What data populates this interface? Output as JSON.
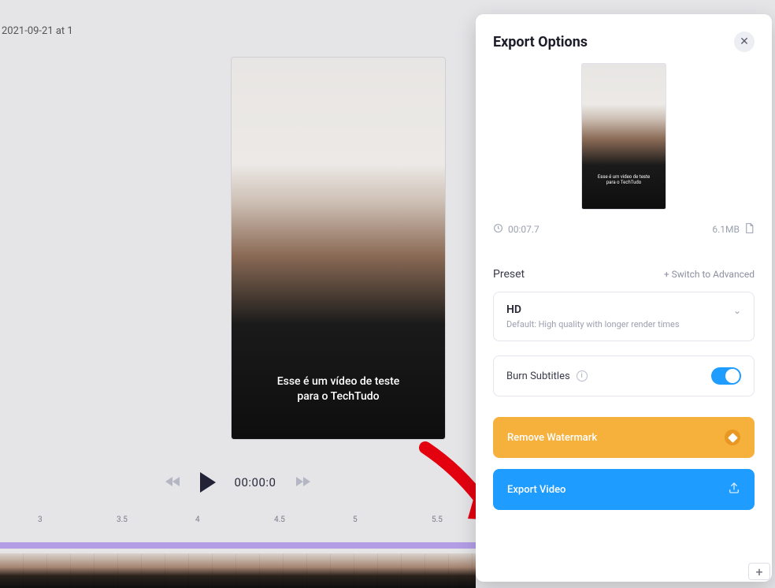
{
  "main": {
    "filename": "2021-09-21 at 1",
    "caption_line1": "Esse é um vídeo de teste",
    "caption_line2": "para o TechTudo",
    "timecode": "00:00:0",
    "ruler_ticks": [
      "3",
      "3.5",
      "4",
      "4.5",
      "5",
      "5.5"
    ]
  },
  "panel": {
    "title": "Export Options",
    "duration": "00:07.7",
    "filesize": "6.1MB",
    "preset_label": "Preset",
    "switch_label": "+ Switch to Advanced",
    "preset_name": "HD",
    "preset_desc": "Default: High quality with longer render times",
    "burn_label": "Burn Subtitles",
    "remove_watermark_label": "Remove Watermark",
    "export_label": "Export Video",
    "mini_caption_line1": "Esse é um video de teste",
    "mini_caption_line2": "para o TechTudo"
  }
}
